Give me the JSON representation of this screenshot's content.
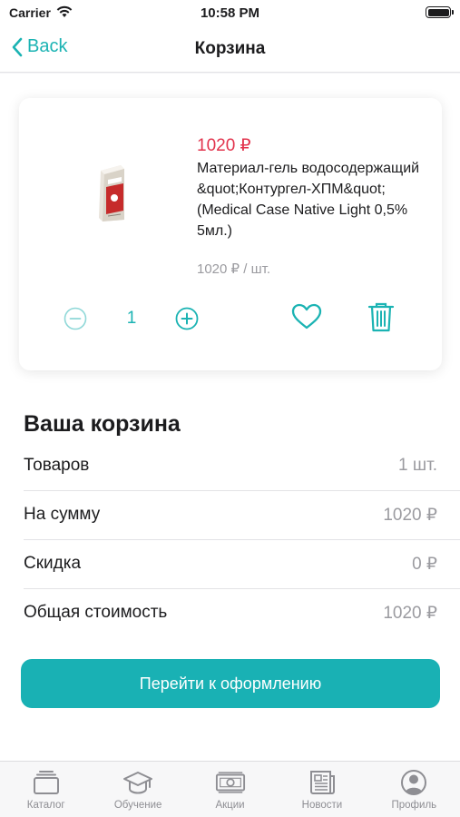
{
  "status_bar": {
    "carrier": "Carrier",
    "time": "10:58 PM"
  },
  "nav": {
    "back_label": "Back",
    "title": "Корзина"
  },
  "cart_item": {
    "price": "1020 ₽",
    "name": "Материал-гель водосодержащий &quot;Контургел-ХПМ&quot; (Medical Case Native Light 0,5% 5мл.)",
    "unit_price": "1020 ₽ / шт.",
    "quantity": "1",
    "image_icon": "product-package-image"
  },
  "summary": {
    "title": "Ваша корзина",
    "rows": [
      {
        "label": "Товаров",
        "value": "1 шт."
      },
      {
        "label": "На сумму",
        "value": "1020 ₽"
      },
      {
        "label": "Скидка",
        "value": "0 ₽"
      },
      {
        "label": "Общая стоимость",
        "value": "1020 ₽"
      }
    ]
  },
  "checkout_label": "Перейти к оформлению",
  "tabs": [
    {
      "label": "Каталог",
      "icon": "catalog-icon"
    },
    {
      "label": "Обучение",
      "icon": "graduation-cap-icon"
    },
    {
      "label": "Акции",
      "icon": "money-icon"
    },
    {
      "label": "Новости",
      "icon": "newspaper-icon"
    },
    {
      "label": "Профиль",
      "icon": "profile-icon"
    }
  ],
  "colors": {
    "accent": "#1bb3b3",
    "price": "#e2334c",
    "muted": "#9b9ba0"
  }
}
